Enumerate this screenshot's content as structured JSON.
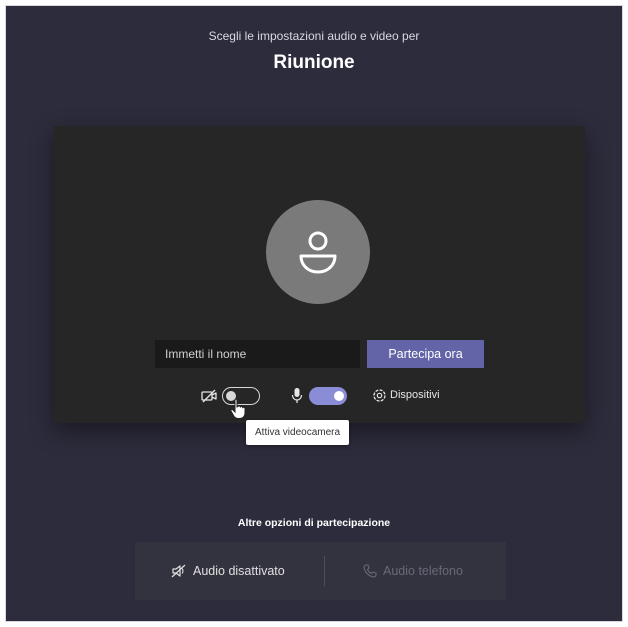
{
  "header": {
    "subtitle": "Scegli le impostazioni audio e video per",
    "title": "Riunione"
  },
  "preview": {
    "avatar_icon": "person-icon",
    "name_placeholder": "Immetti il nome",
    "name_value": "",
    "join_label": "Partecipa ora"
  },
  "controls": {
    "camera_icon": "camera-off-icon",
    "camera_on": false,
    "mic_icon": "microphone-icon",
    "mic_on": true,
    "devices_icon": "gear-icon",
    "devices_label": "Dispositivi"
  },
  "tooltip": {
    "text": "Attiva videocamera"
  },
  "other_options": {
    "title": "Altre opzioni di partecipazione",
    "audio_off_label": "Audio disattivato",
    "audio_off_icon": "speaker-off-icon",
    "phone_label": "Audio telefono",
    "phone_icon": "phone-icon"
  },
  "colors": {
    "background": "#2d2c3c",
    "preview_bg": "#262626",
    "accent": "#6264a7",
    "toggle_on": "#8b8cd6",
    "avatar": "#7a7a7a"
  }
}
